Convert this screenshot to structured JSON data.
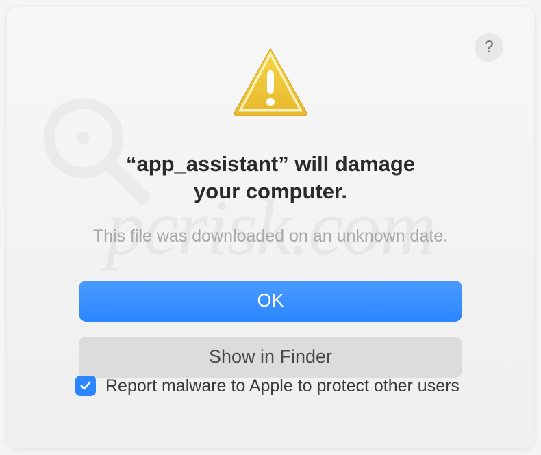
{
  "dialog": {
    "help_label": "?",
    "title_line1": "“app_assistant” will damage",
    "title_line2": "your computer.",
    "subtitle": "This file was downloaded on an unknown date.",
    "primary_button": "OK",
    "secondary_button": "Show in Finder",
    "checkbox_label": "Report malware to Apple to protect other users",
    "checkbox_checked": true
  },
  "watermark": {
    "text": "pcrisk.com"
  },
  "icons": {
    "warning": "warning-triangle",
    "help": "question-mark",
    "check": "checkmark",
    "magnifier": "magnifying-glass"
  }
}
